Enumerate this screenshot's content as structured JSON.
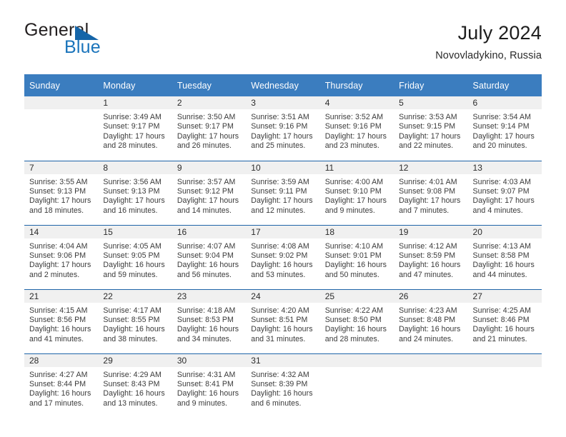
{
  "brand": {
    "name_part1": "General",
    "name_part2": "Blue",
    "flag_icon": "triangle-flag-icon"
  },
  "header": {
    "title": "July 2024",
    "subtitle": "Novovladykino, Russia"
  },
  "colors": {
    "header_blue": "#3b7dbf",
    "row_divider_blue": "#1e64a8",
    "daynum_band": "#f0f0f0",
    "brand_blue": "#1a74bb"
  },
  "calendar": {
    "weekday_headers": [
      "Sunday",
      "Monday",
      "Tuesday",
      "Wednesday",
      "Thursday",
      "Friday",
      "Saturday"
    ],
    "weeks": [
      [
        {
          "day": "",
          "empty": true,
          "sunrise": "",
          "sunset": "",
          "daylight_line1": "",
          "daylight_line2": ""
        },
        {
          "day": "1",
          "sunrise": "Sunrise: 3:49 AM",
          "sunset": "Sunset: 9:17 PM",
          "daylight_line1": "Daylight: 17 hours",
          "daylight_line2": "and 28 minutes."
        },
        {
          "day": "2",
          "sunrise": "Sunrise: 3:50 AM",
          "sunset": "Sunset: 9:17 PM",
          "daylight_line1": "Daylight: 17 hours",
          "daylight_line2": "and 26 minutes."
        },
        {
          "day": "3",
          "sunrise": "Sunrise: 3:51 AM",
          "sunset": "Sunset: 9:16 PM",
          "daylight_line1": "Daylight: 17 hours",
          "daylight_line2": "and 25 minutes."
        },
        {
          "day": "4",
          "sunrise": "Sunrise: 3:52 AM",
          "sunset": "Sunset: 9:16 PM",
          "daylight_line1": "Daylight: 17 hours",
          "daylight_line2": "and 23 minutes."
        },
        {
          "day": "5",
          "sunrise": "Sunrise: 3:53 AM",
          "sunset": "Sunset: 9:15 PM",
          "daylight_line1": "Daylight: 17 hours",
          "daylight_line2": "and 22 minutes."
        },
        {
          "day": "6",
          "sunrise": "Sunrise: 3:54 AM",
          "sunset": "Sunset: 9:14 PM",
          "daylight_line1": "Daylight: 17 hours",
          "daylight_line2": "and 20 minutes."
        }
      ],
      [
        {
          "day": "7",
          "sunrise": "Sunrise: 3:55 AM",
          "sunset": "Sunset: 9:13 PM",
          "daylight_line1": "Daylight: 17 hours",
          "daylight_line2": "and 18 minutes."
        },
        {
          "day": "8",
          "sunrise": "Sunrise: 3:56 AM",
          "sunset": "Sunset: 9:13 PM",
          "daylight_line1": "Daylight: 17 hours",
          "daylight_line2": "and 16 minutes."
        },
        {
          "day": "9",
          "sunrise": "Sunrise: 3:57 AM",
          "sunset": "Sunset: 9:12 PM",
          "daylight_line1": "Daylight: 17 hours",
          "daylight_line2": "and 14 minutes."
        },
        {
          "day": "10",
          "sunrise": "Sunrise: 3:59 AM",
          "sunset": "Sunset: 9:11 PM",
          "daylight_line1": "Daylight: 17 hours",
          "daylight_line2": "and 12 minutes."
        },
        {
          "day": "11",
          "sunrise": "Sunrise: 4:00 AM",
          "sunset": "Sunset: 9:10 PM",
          "daylight_line1": "Daylight: 17 hours",
          "daylight_line2": "and 9 minutes."
        },
        {
          "day": "12",
          "sunrise": "Sunrise: 4:01 AM",
          "sunset": "Sunset: 9:08 PM",
          "daylight_line1": "Daylight: 17 hours",
          "daylight_line2": "and 7 minutes."
        },
        {
          "day": "13",
          "sunrise": "Sunrise: 4:03 AM",
          "sunset": "Sunset: 9:07 PM",
          "daylight_line1": "Daylight: 17 hours",
          "daylight_line2": "and 4 minutes."
        }
      ],
      [
        {
          "day": "14",
          "sunrise": "Sunrise: 4:04 AM",
          "sunset": "Sunset: 9:06 PM",
          "daylight_line1": "Daylight: 17 hours",
          "daylight_line2": "and 2 minutes."
        },
        {
          "day": "15",
          "sunrise": "Sunrise: 4:05 AM",
          "sunset": "Sunset: 9:05 PM",
          "daylight_line1": "Daylight: 16 hours",
          "daylight_line2": "and 59 minutes."
        },
        {
          "day": "16",
          "sunrise": "Sunrise: 4:07 AM",
          "sunset": "Sunset: 9:04 PM",
          "daylight_line1": "Daylight: 16 hours",
          "daylight_line2": "and 56 minutes."
        },
        {
          "day": "17",
          "sunrise": "Sunrise: 4:08 AM",
          "sunset": "Sunset: 9:02 PM",
          "daylight_line1": "Daylight: 16 hours",
          "daylight_line2": "and 53 minutes."
        },
        {
          "day": "18",
          "sunrise": "Sunrise: 4:10 AM",
          "sunset": "Sunset: 9:01 PM",
          "daylight_line1": "Daylight: 16 hours",
          "daylight_line2": "and 50 minutes."
        },
        {
          "day": "19",
          "sunrise": "Sunrise: 4:12 AM",
          "sunset": "Sunset: 8:59 PM",
          "daylight_line1": "Daylight: 16 hours",
          "daylight_line2": "and 47 minutes."
        },
        {
          "day": "20",
          "sunrise": "Sunrise: 4:13 AM",
          "sunset": "Sunset: 8:58 PM",
          "daylight_line1": "Daylight: 16 hours",
          "daylight_line2": "and 44 minutes."
        }
      ],
      [
        {
          "day": "21",
          "sunrise": "Sunrise: 4:15 AM",
          "sunset": "Sunset: 8:56 PM",
          "daylight_line1": "Daylight: 16 hours",
          "daylight_line2": "and 41 minutes."
        },
        {
          "day": "22",
          "sunrise": "Sunrise: 4:17 AM",
          "sunset": "Sunset: 8:55 PM",
          "daylight_line1": "Daylight: 16 hours",
          "daylight_line2": "and 38 minutes."
        },
        {
          "day": "23",
          "sunrise": "Sunrise: 4:18 AM",
          "sunset": "Sunset: 8:53 PM",
          "daylight_line1": "Daylight: 16 hours",
          "daylight_line2": "and 34 minutes."
        },
        {
          "day": "24",
          "sunrise": "Sunrise: 4:20 AM",
          "sunset": "Sunset: 8:51 PM",
          "daylight_line1": "Daylight: 16 hours",
          "daylight_line2": "and 31 minutes."
        },
        {
          "day": "25",
          "sunrise": "Sunrise: 4:22 AM",
          "sunset": "Sunset: 8:50 PM",
          "daylight_line1": "Daylight: 16 hours",
          "daylight_line2": "and 28 minutes."
        },
        {
          "day": "26",
          "sunrise": "Sunrise: 4:23 AM",
          "sunset": "Sunset: 8:48 PM",
          "daylight_line1": "Daylight: 16 hours",
          "daylight_line2": "and 24 minutes."
        },
        {
          "day": "27",
          "sunrise": "Sunrise: 4:25 AM",
          "sunset": "Sunset: 8:46 PM",
          "daylight_line1": "Daylight: 16 hours",
          "daylight_line2": "and 21 minutes."
        }
      ],
      [
        {
          "day": "28",
          "sunrise": "Sunrise: 4:27 AM",
          "sunset": "Sunset: 8:44 PM",
          "daylight_line1": "Daylight: 16 hours",
          "daylight_line2": "and 17 minutes."
        },
        {
          "day": "29",
          "sunrise": "Sunrise: 4:29 AM",
          "sunset": "Sunset: 8:43 PM",
          "daylight_line1": "Daylight: 16 hours",
          "daylight_line2": "and 13 minutes."
        },
        {
          "day": "30",
          "sunrise": "Sunrise: 4:31 AM",
          "sunset": "Sunset: 8:41 PM",
          "daylight_line1": "Daylight: 16 hours",
          "daylight_line2": "and 9 minutes."
        },
        {
          "day": "31",
          "sunrise": "Sunrise: 4:32 AM",
          "sunset": "Sunset: 8:39 PM",
          "daylight_line1": "Daylight: 16 hours",
          "daylight_line2": "and 6 minutes."
        },
        {
          "day": "",
          "empty": true,
          "sunrise": "",
          "sunset": "",
          "daylight_line1": "",
          "daylight_line2": ""
        },
        {
          "day": "",
          "empty": true,
          "sunrise": "",
          "sunset": "",
          "daylight_line1": "",
          "daylight_line2": ""
        },
        {
          "day": "",
          "empty": true,
          "sunrise": "",
          "sunset": "",
          "daylight_line1": "",
          "daylight_line2": ""
        }
      ]
    ]
  }
}
